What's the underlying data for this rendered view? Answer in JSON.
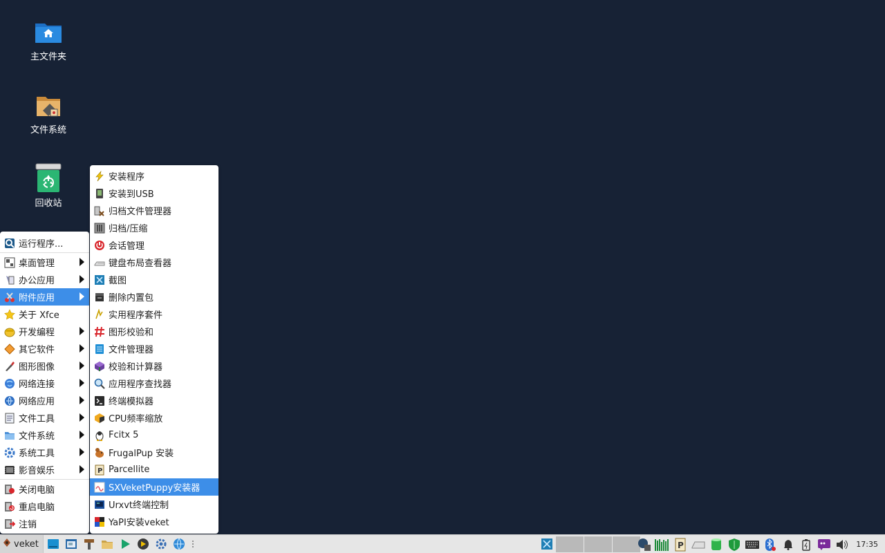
{
  "desktop": {
    "icons": [
      {
        "label": "主文件夹",
        "icon": "home-folder-icon"
      },
      {
        "label": "文件系统",
        "icon": "filesystem-icon"
      },
      {
        "label": "回收站",
        "icon": "trash-icon"
      }
    ]
  },
  "main_menu": {
    "items": [
      {
        "label": "运行程序...",
        "icon": "run-program-icon",
        "submenu": false
      },
      {
        "label": "桌面管理",
        "icon": "desktop-settings-icon",
        "submenu": true
      },
      {
        "label": "办公应用",
        "icon": "office-icon",
        "submenu": true
      },
      {
        "label": "附件应用",
        "icon": "accessories-icon",
        "submenu": true,
        "active": true
      },
      {
        "label": "关于 Xfce",
        "icon": "star-icon",
        "submenu": false
      },
      {
        "label": "开发编程",
        "icon": "development-icon",
        "submenu": true
      },
      {
        "label": "其它软件",
        "icon": "other-software-icon",
        "submenu": true
      },
      {
        "label": "图形图像",
        "icon": "graphics-icon",
        "submenu": true
      },
      {
        "label": "网络连接",
        "icon": "network-connect-icon",
        "submenu": true
      },
      {
        "label": "网络应用",
        "icon": "network-apps-icon",
        "submenu": true
      },
      {
        "label": "文件工具",
        "icon": "file-tools-icon",
        "submenu": true
      },
      {
        "label": "文件系统",
        "icon": "filesystem-menu-icon",
        "submenu": true
      },
      {
        "label": "系统工具",
        "icon": "system-tools-icon",
        "submenu": true
      },
      {
        "label": "影音娱乐",
        "icon": "multimedia-icon",
        "submenu": true
      },
      {
        "label": "关闭电脑",
        "icon": "shutdown-icon",
        "submenu": false
      },
      {
        "label": "重启电脑",
        "icon": "reboot-icon",
        "submenu": false
      },
      {
        "label": "注销",
        "icon": "logout-icon",
        "submenu": false
      }
    ]
  },
  "submenu": {
    "items": [
      {
        "label": "安装程序",
        "icon": "installer-icon"
      },
      {
        "label": "安装到USB",
        "icon": "usb-install-icon"
      },
      {
        "label": "归档文件管理器",
        "icon": "archive-manager-icon"
      },
      {
        "label": "归档/压缩",
        "icon": "archive-compress-icon"
      },
      {
        "label": "会话管理",
        "icon": "session-manager-icon"
      },
      {
        "label": "键盘布局查看器",
        "icon": "keyboard-layout-icon"
      },
      {
        "label": "截图",
        "icon": "screenshot-icon"
      },
      {
        "label": "删除内置包",
        "icon": "remove-builtin-icon"
      },
      {
        "label": "实用程序套件",
        "icon": "utility-suite-icon"
      },
      {
        "label": "图形校验和",
        "icon": "checksum-icon"
      },
      {
        "label": "文件管理器",
        "icon": "file-manager-icon"
      },
      {
        "label": "校验和计算器",
        "icon": "hash-calculator-icon"
      },
      {
        "label": "应用程序查找器",
        "icon": "app-finder-icon"
      },
      {
        "label": "终端模拟器",
        "icon": "terminal-icon"
      },
      {
        "label": "CPU频率缩放",
        "icon": "cpu-freq-icon"
      },
      {
        "label": "Fcitx 5",
        "icon": "fcitx-icon"
      },
      {
        "label": "FrugalPup 安装",
        "icon": "frugalpup-icon"
      },
      {
        "label": "Parcellite",
        "icon": "parcellite-icon"
      },
      {
        "label": "SXVeketPuppy安装器",
        "icon": "sxveket-installer-icon",
        "active": true
      },
      {
        "label": "Urxvt终端控制",
        "icon": "urxvt-icon"
      },
      {
        "label": "YaPI安装veket",
        "icon": "yapi-icon"
      }
    ]
  },
  "taskbar": {
    "start_label": "veket",
    "launchers": [
      "desktop-icon",
      "window-icon",
      "tools-icon",
      "folder-icon",
      "play-icon",
      "gear-arrow-icon",
      "settings-icon",
      "browser-icon",
      "handle-icon"
    ],
    "tray": [
      "screen-icon",
      "network-icon",
      "net-monitor-icon",
      "parcellite-tray-icon",
      "drive-icon",
      "disk-icon",
      "shield-icon",
      "keyboard-icon",
      "bluetooth-icon",
      "bell-icon",
      "power-icon",
      "chat-icon",
      "volume-icon"
    ],
    "clock": "17:35"
  },
  "colors": {
    "desktop_bg": "#172235",
    "highlight": "#3d8ee8",
    "menu_bg": "#ffffff",
    "taskbar_bg": "#e6e6e6"
  }
}
